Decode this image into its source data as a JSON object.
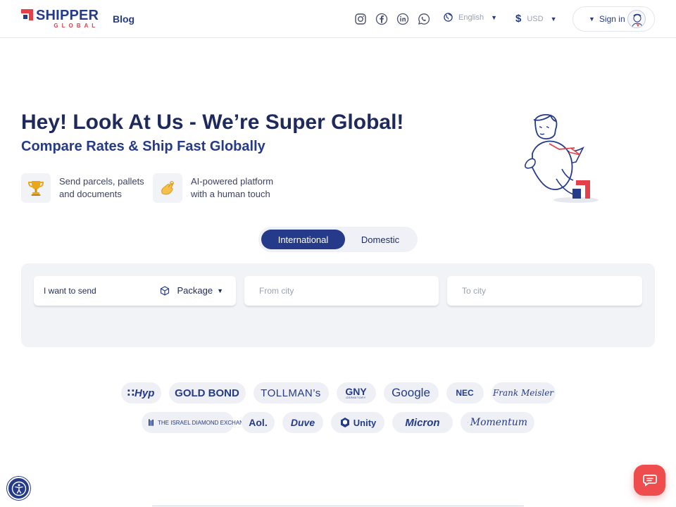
{
  "header": {
    "logo_main": "SHIPPER",
    "logo_sub": "GLOBAL",
    "blog": "Blog",
    "language": "English",
    "currency_symbol": "$",
    "currency": "USD",
    "signin": "Sign in",
    "social_icons": [
      "instagram-icon",
      "facebook-icon",
      "linkedin-icon",
      "whatsapp-icon"
    ]
  },
  "hero": {
    "title": "Hey! Look At Us - We’re Super Global!",
    "subtitle": "Compare Rates & Ship Fast Globally",
    "features": [
      {
        "icon": "trophy-icon",
        "text": "Send parcels, pallets and documents"
      },
      {
        "icon": "hand-icon",
        "text": "AI-powered platform with a human touch"
      }
    ]
  },
  "tabs": {
    "international": "International",
    "domestic": "Domestic",
    "active": "International"
  },
  "form": {
    "send_label": "I want to send",
    "package_value": "Package",
    "from_placeholder": "From city",
    "to_placeholder": "To city"
  },
  "clients": {
    "row1": [
      "∷Hyp",
      "GOLD BOND",
      "TOLLMAN’s",
      "GNY",
      "Google",
      "NEC",
      "Frank Meisler"
    ],
    "row2": [
      "THE ISRAEL DIAMOND EXCHANGE LTD.",
      "Aol.",
      "Duve",
      "Unity",
      "Micron",
      "Momentum"
    ],
    "gny_sub": "GERMITORY"
  },
  "colors": {
    "brand_blue": "#253b8a",
    "brand_red": "#e5404a",
    "panel_bg": "#f2f3f7"
  }
}
